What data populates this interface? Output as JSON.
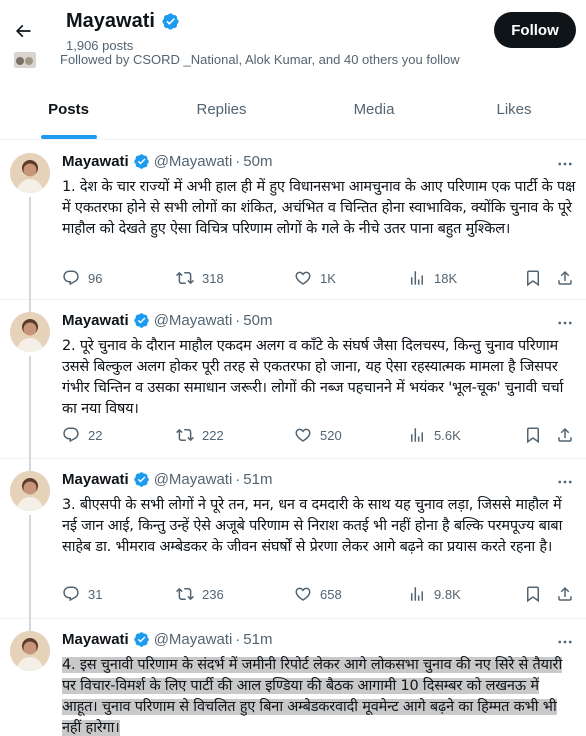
{
  "header": {
    "name": "Mayawati",
    "posts_count": "1,906 posts",
    "follow_label": "Follow",
    "followed_by": "Followed by CSORD _National, Alok Kumar, and 40 others you follow"
  },
  "tabs": [
    {
      "label": "Posts",
      "active": true
    },
    {
      "label": "Replies",
      "active": false
    },
    {
      "label": "Media",
      "active": false
    },
    {
      "label": "Likes",
      "active": false
    }
  ],
  "colors": {
    "accent": "#1d9bf0",
    "text": "#0f1419",
    "muted": "#536471",
    "verified": "#1d9bf0"
  },
  "posts": [
    {
      "author": "Mayawati",
      "handle": "@Mayawati",
      "time": "50m",
      "text": "1. देश के चार राज्यों में अभी हाल ही में हुए विधानसभा आमचुनाव के आए परिणाम एक पार्टी के पक्ष में एकतरफा होने से सभी लोगों का शंकित, अचंभित व चिन्तित होना स्वाभाविक, क्योंकि चुनाव के पूरे माहौल को देखते हुए ऐसा विचित्र परिणाम लोगों के गले के नीचे उतर पाना बहुत मुश्किल।",
      "replies": "96",
      "reposts": "318",
      "likes": "1K",
      "views": "18K"
    },
    {
      "author": "Mayawati",
      "handle": "@Mayawati",
      "time": "50m",
      "text": "2. पूरे चुनाव के दौरान माहौल एकदम अलग व काँटे के संघर्ष जैसा दिलचस्प, किन्तु चुनाव परिणाम उससे बिल्कुल अलग होकर पूरी तरह से एकतरफा हो जाना, यह ऐसा रहस्यात्मक मामला है जिसपर गंभीर चिन्तिन व उसका समाधान जरूरी। लोगों की नब्ज पहचानने में भयंकर 'भूल-चूक' चुनावी चर्चा का नया विषय।",
      "replies": "22",
      "reposts": "222",
      "likes": "520",
      "views": "5.6K"
    },
    {
      "author": "Mayawati",
      "handle": "@Mayawati",
      "time": "51m",
      "text": "3. बीएसपी के सभी लोगों ने पूरे तन, मन, धन व दमदारी के साथ यह चुनाव लड़ा, जिससे माहौल में नई जान आई, किन्तु उन्हें ऐसे अजूबे परिणाम से निराश कतई भी नहीं होना है बल्कि परमपूज्य बाबा साहेब डा. भीमराव अम्बेडकर के जीवन संघर्षों से प्रेरणा लेकर आगे बढ़ने का प्रयास करते रहना है।",
      "replies": "31",
      "reposts": "236",
      "likes": "658",
      "views": "9.8K"
    },
    {
      "author": "Mayawati",
      "handle": "@Mayawati",
      "time": "51m",
      "text": "4. इस चुनावी परिणाम के संदर्भ में जमीनी रिपोर्ट लेकर आगे लोकसभा चुनाव की नए सिरे से तैयारी पर विचार-विमर्श के लिए पार्टी की आल इण्डिया की बैठक आगामी 10 दिसम्बर को लखनऊ में आहूत। चुनाव परिणाम से विचलित हुए बिना अम्बेडकरवादी मूवमेन्ट आगे बढ़ने का हिम्मत कभी भी नहीं हारेगा।"
    }
  ]
}
